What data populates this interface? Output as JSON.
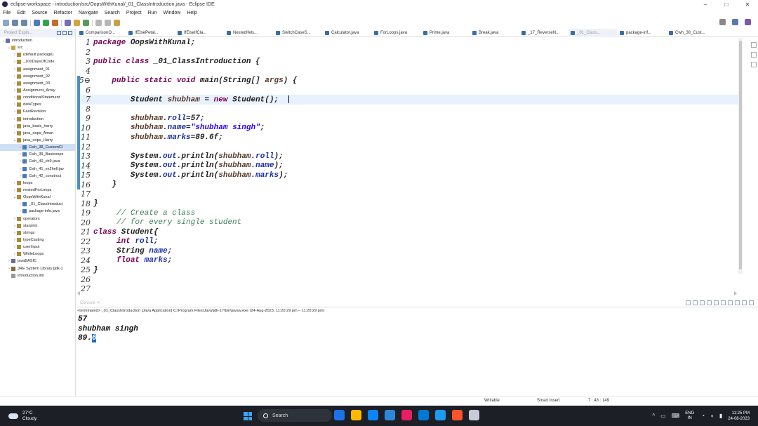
{
  "window": {
    "title": "eclipse-workspace - introduction/src/OopsWithKunal/_01_ClassIntroduction.java - Eclipse IDE",
    "minimize": "–",
    "maximize": "□",
    "close": "✕"
  },
  "menu": [
    "File",
    "Edit",
    "Source",
    "Refactor",
    "Navigate",
    "Search",
    "Project",
    "Run",
    "Window",
    "Help"
  ],
  "tabs": [
    "ComparisonO...",
    "IfElsePetal...",
    "IfElseIfCla...",
    "NestedIfels...",
    "SwitchCaseS...",
    "Calculator.java",
    "ForLoops.java",
    "Prime.java",
    "Break.java",
    "_17_ReverseN...",
    "_01_Class...",
    "package-inf...",
    "Cwh_38_Cust..."
  ],
  "explorer": {
    "header": "Project Explo...",
    "tree": [
      {
        "label": "introduction",
        "indent": 0,
        "arrow": "⌄",
        "icon": "project"
      },
      {
        "label": "src",
        "indent": 1,
        "arrow": "⌄",
        "icon": "folder"
      },
      {
        "label": "(default package)",
        "indent": 2,
        "arrow": "›",
        "icon": "package"
      },
      {
        "label": "_100DaysOfCode",
        "indent": 2,
        "arrow": "›",
        "icon": "package"
      },
      {
        "label": "assignment_01",
        "indent": 2,
        "arrow": "›",
        "icon": "package"
      },
      {
        "label": "assignment_02",
        "indent": 2,
        "arrow": "›",
        "icon": "package"
      },
      {
        "label": "assignment_03",
        "indent": 2,
        "arrow": "›",
        "icon": "package"
      },
      {
        "label": "Assignment_Array",
        "indent": 2,
        "arrow": "›",
        "icon": "package"
      },
      {
        "label": "conditionalStatement",
        "indent": 2,
        "arrow": "›",
        "icon": "package"
      },
      {
        "label": "dataTypes",
        "indent": 2,
        "arrow": "›",
        "icon": "package"
      },
      {
        "label": "FastRevision",
        "indent": 2,
        "arrow": "›",
        "icon": "package"
      },
      {
        "label": "introduction",
        "indent": 2,
        "arrow": "›",
        "icon": "package"
      },
      {
        "label": "java_basic_harry",
        "indent": 2,
        "arrow": "›",
        "icon": "package"
      },
      {
        "label": "java_oops_Aman",
        "indent": 2,
        "arrow": "›",
        "icon": "package"
      },
      {
        "label": "java_oops_Harry",
        "indent": 2,
        "arrow": "⌄",
        "icon": "package"
      },
      {
        "label": "Cwh_38_CustomCl",
        "indent": 3,
        "arrow": "›",
        "icon": "java",
        "selected": true
      },
      {
        "label": "Cwh_39_Basicoops",
        "indent": 3,
        "arrow": "›",
        "icon": "java"
      },
      {
        "label": "Cwh_40_ch9.java",
        "indent": 3,
        "arrow": "›",
        "icon": "java"
      },
      {
        "label": "Cwh_41_ex2hell.jav",
        "indent": 3,
        "arrow": "›",
        "icon": "java"
      },
      {
        "label": "Cwh_42_construct",
        "indent": 3,
        "arrow": "›",
        "icon": "java"
      },
      {
        "label": "loops",
        "indent": 2,
        "arrow": "›",
        "icon": "package"
      },
      {
        "label": "nestedForLoops",
        "indent": 2,
        "arrow": "›",
        "icon": "package"
      },
      {
        "label": "OopsWithKunal",
        "indent": 2,
        "arrow": "⌄",
        "icon": "package"
      },
      {
        "label": "_01_ClassIntroduct",
        "indent": 3,
        "arrow": "›",
        "icon": "java"
      },
      {
        "label": "package-info.java",
        "indent": 3,
        "arrow": "›",
        "icon": "java"
      },
      {
        "label": "operators",
        "indent": 2,
        "arrow": "›",
        "icon": "package"
      },
      {
        "label": "starprint",
        "indent": 2,
        "arrow": "›",
        "icon": "package"
      },
      {
        "label": "strings",
        "indent": 2,
        "arrow": "›",
        "icon": "package"
      },
      {
        "label": "typeCasting",
        "indent": 2,
        "arrow": "›",
        "icon": "package"
      },
      {
        "label": "userInput",
        "indent": 2,
        "arrow": "›",
        "icon": "package"
      },
      {
        "label": "WhileLoops",
        "indent": 2,
        "arrow": "›",
        "icon": "package"
      },
      {
        "label": "javaBASIC",
        "indent": 1,
        "arrow": "›",
        "icon": "project"
      },
      {
        "label": "JRE System Library [jdk-1",
        "indent": 1,
        "arrow": "›",
        "icon": "library"
      },
      {
        "label": "introduction.iml",
        "indent": 1,
        "arrow": "",
        "icon": "file"
      }
    ]
  },
  "editor": {
    "lines": [
      {
        "n": "1",
        "html": "<span class='kw'>package</span> OopsWithKunal;"
      },
      {
        "n": "2",
        "html": ""
      },
      {
        "n": "3",
        "html": "<span class='kw'>public class</span> _01_ClassIntroduction {"
      },
      {
        "n": "4",
        "html": ""
      },
      {
        "n": "5⊖",
        "html": "    <span class='kw'>public static void</span> main(String[] <span class='var'>args</span>) {"
      },
      {
        "n": "6",
        "html": ""
      },
      {
        "n": "7",
        "html": "        Student <span class='var'>shubham</span> = <span class='kw'>new</span> Student();",
        "current": true
      },
      {
        "n": "8",
        "html": ""
      },
      {
        "n": "9",
        "html": "        <span class='var'>shubham</span>.<span class='fld'>roll</span>=57;"
      },
      {
        "n": "10",
        "html": "        <span class='var'>shubham</span>.<span class='fld'>name</span>=<span class='str'>\"shubham singh\"</span>;"
      },
      {
        "n": "11",
        "html": "        <span class='var'>shubham</span>.<span class='fld'>marks</span>=89.6f;"
      },
      {
        "n": "12",
        "html": ""
      },
      {
        "n": "13",
        "html": "        System.<span class='fld'>out</span>.println(<span class='var'>shubham</span>.<span class='fld'>roll</span>);"
      },
      {
        "n": "14",
        "html": "        System.<span class='fld'>out</span>.println(<span class='var'>shubham</span>.<span class='fld'>name</span>);"
      },
      {
        "n": "15",
        "html": "        System.<span class='fld'>out</span>.println(<span class='var'>shubham</span>.<span class='fld'>marks</span>);"
      },
      {
        "n": "16",
        "html": "    }"
      },
      {
        "n": "17",
        "html": ""
      },
      {
        "n": "18",
        "html": "}"
      },
      {
        "n": "19",
        "html": "     <span class='cmt'>// Create a class</span>"
      },
      {
        "n": "20",
        "html": "     <span class='cmt'>// for every single student</span>"
      },
      {
        "n": "21",
        "html": "<span class='kw'>class</span> Student{"
      },
      {
        "n": "22",
        "html": "     <span class='kw'>int</span> <span class='fld'>roll</span>;"
      },
      {
        "n": "23",
        "html": "     String <span class='fld'>name</span>;"
      },
      {
        "n": "24",
        "html": "     <span class='kw'>float</span> <span class='fld'>marks</span>;"
      },
      {
        "n": "25",
        "html": "}"
      },
      {
        "n": "26",
        "html": ""
      },
      {
        "n": "27",
        "html": ""
      }
    ]
  },
  "console": {
    "tab": "Console ✕",
    "terminated": "<terminated> _01_ClassIntroduction [Java Application] C:\\Program Files\\Java\\jdk-17\\bin\\javaw.exe  (24-Aug-2023, 11:20:29 pm – 11:20:29 pm)",
    "line1": "57",
    "line2": "shubham singh",
    "line3_prefix": "89.",
    "line3_selected": "6"
  },
  "status": {
    "mode": "Writable",
    "insert": "Smart Insert",
    "position": "7 : 43 : 149"
  },
  "taskbar": {
    "temp": "27°C",
    "weather": "Cloudy",
    "search": "Search",
    "lang1": "ENG",
    "lang2": "IN",
    "time": "11:25 PM",
    "date": "24-08-2023",
    "app_colors": [
      "#1a73e8",
      "#ffb900",
      "#0a84ff",
      "#2b88d8",
      "#e91e63",
      "#0078d4",
      "#1d9bf0",
      "#fb542b",
      "#c9c9d9"
    ]
  }
}
